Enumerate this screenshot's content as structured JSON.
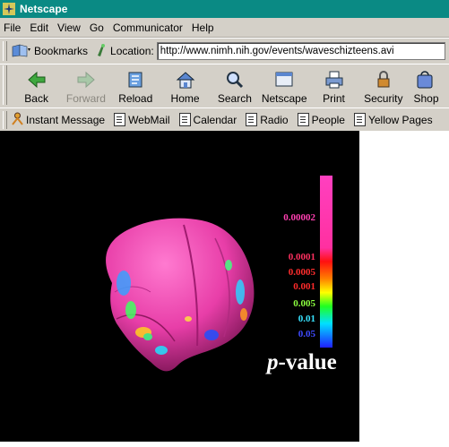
{
  "window": {
    "title": "Netscape"
  },
  "menu": [
    "File",
    "Edit",
    "View",
    "Go",
    "Communicator",
    "Help"
  ],
  "location_bar": {
    "bookmarks_label": "Bookmarks",
    "location_label": "Location:",
    "url": "http://www.nimh.nih.gov/events/waveschizteens.avi"
  },
  "nav_buttons": [
    {
      "label": "Back",
      "icon": "back-arrow-icon",
      "enabled": true
    },
    {
      "label": "Forward",
      "icon": "forward-arrow-icon",
      "enabled": false
    },
    {
      "label": "Reload",
      "icon": "reload-icon",
      "enabled": true
    },
    {
      "label": "Home",
      "icon": "home-icon",
      "enabled": true
    },
    {
      "label": "Search",
      "icon": "search-icon",
      "enabled": true
    },
    {
      "label": "Netscape",
      "icon": "netscape-icon",
      "enabled": true
    },
    {
      "label": "Print",
      "icon": "printer-icon",
      "enabled": true
    },
    {
      "label": "Security",
      "icon": "lock-icon",
      "enabled": true
    },
    {
      "label": "Shop",
      "icon": "shop-icon",
      "enabled": true
    }
  ],
  "personal_toolbar": [
    "Instant Message",
    "WebMail",
    "Calendar",
    "Radio",
    "People",
    "Yellow Pages"
  ],
  "video": {
    "scale_labels": [
      {
        "text": "0.00002",
        "color": "#ff3fb0"
      },
      {
        "text": "0.0001",
        "color": "#ff3060"
      },
      {
        "text": "0.0005",
        "color": "#ff2d2d"
      },
      {
        "text": "0.001",
        "color": "#ff2a2a"
      },
      {
        "text": "0.005",
        "color": "#8cff40"
      },
      {
        "text": "0.01",
        "color": "#37e3ff"
      },
      {
        "text": "0.05",
        "color": "#3f4bff"
      }
    ],
    "p_label_prefix": "p",
    "p_label_suffix": "-value"
  },
  "colors": {
    "titlebar": "#0a8a84",
    "chrome": "#d4d0c8",
    "brain_base": "#e83ea8"
  }
}
